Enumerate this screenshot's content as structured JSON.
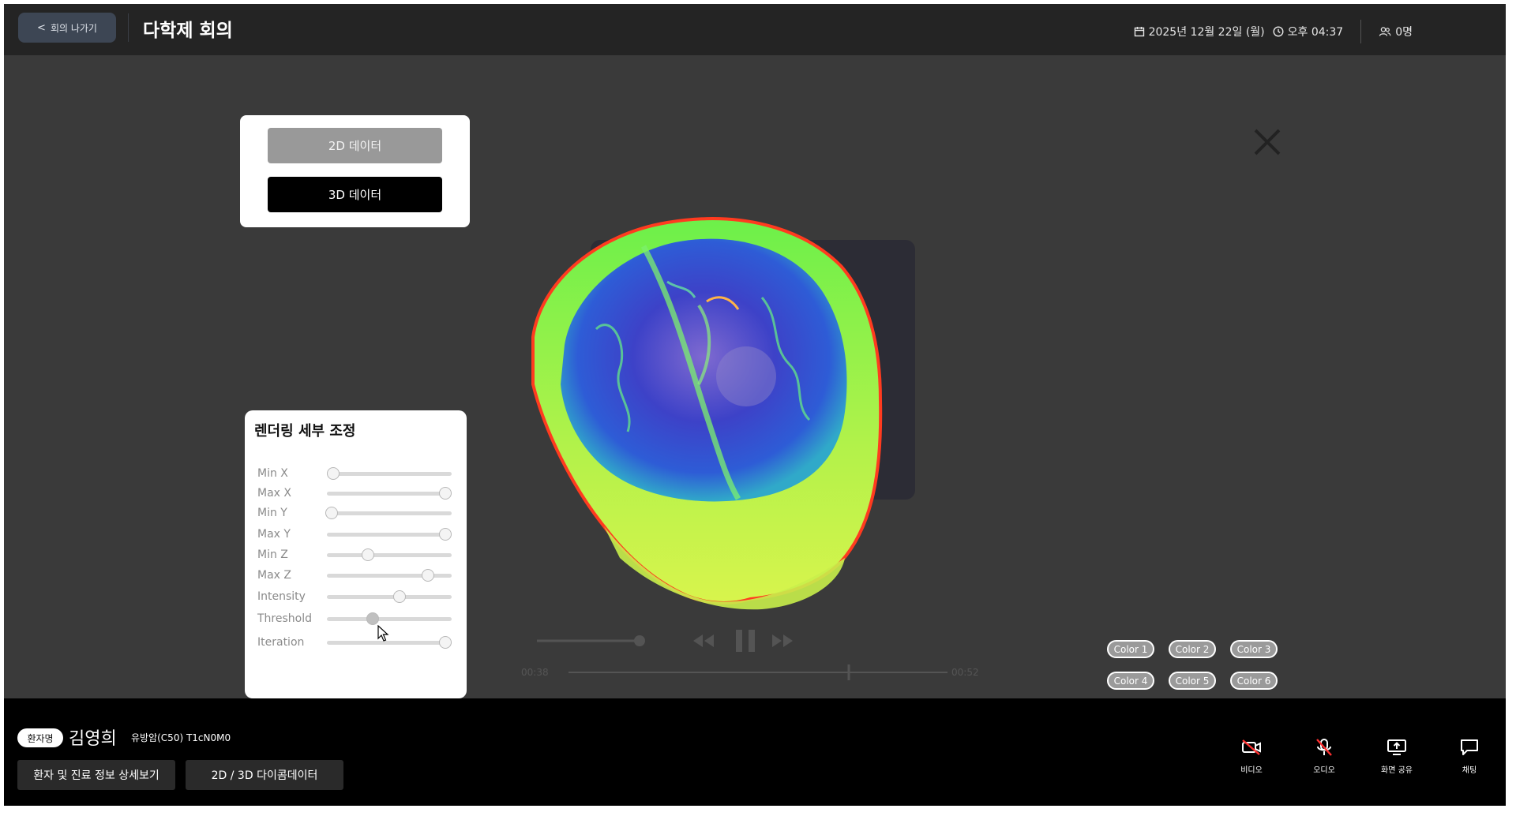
{
  "header": {
    "back_label": "회의 나가기",
    "title": "다학제 회의",
    "date": "2025년 12월 22일 (월)",
    "time": "오후 04:37",
    "participants": "0명"
  },
  "data_tabs": {
    "tab_2d": "2D 데이터",
    "tab_3d": "3D 데이터",
    "selected": "3D 데이터"
  },
  "rendering": {
    "title": "렌더링 세부 조정",
    "sliders": [
      {
        "label": "Min X",
        "value": 0.05
      },
      {
        "label": "Max X",
        "value": 0.95
      },
      {
        "label": "Min Y",
        "value": 0.04
      },
      {
        "label": "Max Y",
        "value": 0.95
      },
      {
        "label": "Min Z",
        "value": 0.33
      },
      {
        "label": "Max Z",
        "value": 0.81
      },
      {
        "label": "Intensity",
        "value": 0.58
      },
      {
        "label": "Threshold",
        "value": 0.37
      },
      {
        "label": "Iteration",
        "value": 0.95
      }
    ]
  },
  "colors": [
    "Color 1",
    "Color 2",
    "Color 3",
    "Color 4",
    "Color 5",
    "Color 6"
  ],
  "patient": {
    "badge": "환자명",
    "name": "김영희",
    "diagnosis": "유방암(C50) T1cN0M0",
    "detail_button": "환자 및 진료 정보 상세보기",
    "data_button": "2D / 3D 다이콤데이터"
  },
  "media": {
    "video": "비디오",
    "audio": "오디오",
    "share": "화면 공유",
    "chat": "채팅"
  },
  "video_controls": {
    "time_start": "00:38",
    "time_end": "00:52"
  }
}
